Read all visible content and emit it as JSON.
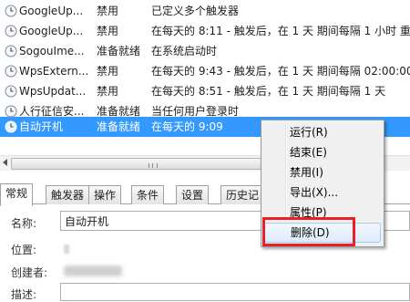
{
  "task_list": {
    "rows": [
      {
        "name": "GoogleUp...",
        "status": "禁用",
        "trigger": "已定义多个触发器",
        "selected": false
      },
      {
        "name": "GoogleUp...",
        "status": "禁用",
        "trigger": "在每天的 8:11 - 触发后，在 1 天 期间每隔 1 小时 重复",
        "selected": false
      },
      {
        "name": "SogouIme...",
        "status": "准备就绪",
        "trigger": "在系统启动时",
        "selected": false
      },
      {
        "name": "WpsExtern...",
        "status": "禁用",
        "trigger": "在每天的 9:43 - 触发后，在 1 天 期间每隔 02:00:00",
        "selected": false
      },
      {
        "name": "WpsUpdat...",
        "status": "禁用",
        "trigger": "在每天的 8:51 - 触发后，在 1 天 期间每隔 1 天",
        "selected": false
      },
      {
        "name": "人行征信安...",
        "status": "准备就绪",
        "trigger": "当任何用户登录时",
        "selected": false
      },
      {
        "name": "自动开机",
        "status": "准备就绪",
        "trigger": "在每天的 9:09",
        "selected": true
      }
    ]
  },
  "details": {
    "tabs": [
      "常规",
      "触发器",
      "操作",
      "条件",
      "设置",
      "历史记"
    ],
    "active_tab": 0,
    "name_label": "名称:",
    "name_value": "自动开机",
    "location_label": "位置:",
    "author_label": "创建者:",
    "description_label": "描述:"
  },
  "context_menu": {
    "items": [
      "运行(R)",
      "结束(E)",
      "禁用(I)",
      "导出(X)...",
      "属性(P)",
      "删除(D)"
    ],
    "hovered_index": 5
  },
  "colors": {
    "selection": "#3399ff",
    "highlight_border": "#e8202a"
  }
}
